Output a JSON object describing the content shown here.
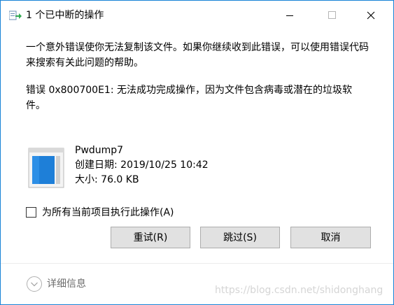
{
  "window": {
    "title": "1 个已中断的操作"
  },
  "message": {
    "line1": "一个意外错误使你无法复制该文件。如果你继续收到此错误，可以使用错误代码来搜索有关此问题的帮助。",
    "line2": "错误 0x800700E1: 无法成功完成操作，因为文件包含病毒或潜在的垃圾软件。"
  },
  "file": {
    "name": "Pwdump7",
    "created": "创建日期: 2019/10/25 10:42",
    "size": "大小: 76.0 KB"
  },
  "checkbox": {
    "label": "为所有当前项目执行此操作(A)",
    "checked": false
  },
  "buttons": {
    "retry": "重试(R)",
    "skip": "跳过(S)",
    "cancel": "取消"
  },
  "details": {
    "label": "详细信息"
  },
  "watermark": "https://blog.csdn.net/shidonghang",
  "colors": {
    "window_border": "#1883d7",
    "button_face": "#e1e1e1",
    "button_border": "#adadad",
    "details_text": "#6d6d6d"
  },
  "icons": {
    "title": "copy-arrow-icon",
    "file": "file-document-icon",
    "details": "chevron-down-circle-icon"
  }
}
